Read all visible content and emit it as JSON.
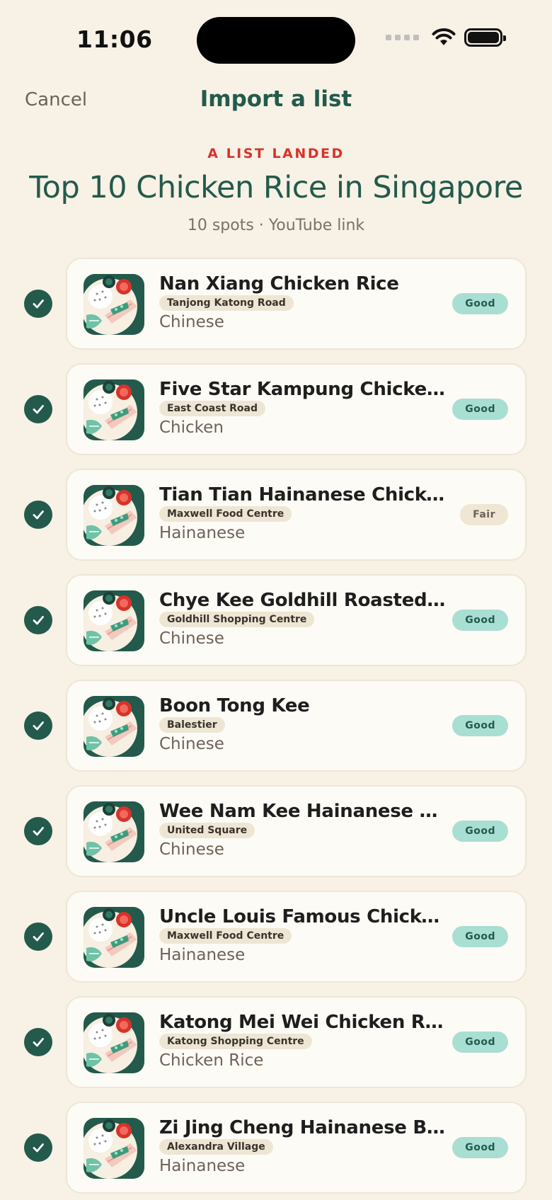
{
  "status_bar": {
    "time": "11:06"
  },
  "nav": {
    "cancel_label": "Cancel",
    "title": "Import a list"
  },
  "header": {
    "eyebrow": "A LIST LANDED",
    "title": "Top 10 Chicken Rice in Singapore",
    "meta": "10 spots · YouTube link"
  },
  "colors": {
    "brand_green": "#235A4B",
    "accent_red": "#D7332B",
    "background": "#F7F1E6",
    "good_badge": "#A9DED3",
    "fair_badge": "#EFE6D3"
  },
  "icons": {
    "check": "checkmark-circle-icon",
    "wifi": "wifi-icon",
    "battery": "battery-icon",
    "thumb": "chicken-rice-plate-icon"
  },
  "spots": [
    {
      "name": "Nan Xiang Chicken Rice",
      "location": "Tanjong Katong Road",
      "cuisine": "Chinese",
      "rating": "Good",
      "selected": true
    },
    {
      "name": "Five Star Kampung Chicken Ri...",
      "location": "East Coast Road",
      "cuisine": "Chicken",
      "rating": "Good",
      "selected": true
    },
    {
      "name": "Tian Tian Hainanese Chicken R...",
      "location": "Maxwell Food Centre",
      "cuisine": "Hainanese",
      "rating": "Fair",
      "selected": true
    },
    {
      "name": "Chye Kee Goldhill Roasted Chi...",
      "location": "Goldhill Shopping Centre",
      "cuisine": "Chinese",
      "rating": "Good",
      "selected": true
    },
    {
      "name": "Boon Tong Kee",
      "location": "Balestier",
      "cuisine": "Chinese",
      "rating": "Good",
      "selected": true
    },
    {
      "name": "Wee Nam Kee Hainanese Chic...",
      "location": "United Square",
      "cuisine": "Chinese",
      "rating": "Good",
      "selected": true
    },
    {
      "name": "Uncle Louis Famous Chicken R...",
      "location": "Maxwell Food Centre",
      "cuisine": "Hainanese",
      "rating": "Good",
      "selected": true
    },
    {
      "name": "Katong Mei Wei Chicken Rice",
      "location": "Katong Shopping Centre",
      "cuisine": "Chicken Rice",
      "rating": "Good",
      "selected": true
    },
    {
      "name": "Zi Jing Cheng Hainanese Bon...",
      "location": "Alexandra Village",
      "cuisine": "Hainanese",
      "rating": "Good",
      "selected": true
    }
  ]
}
